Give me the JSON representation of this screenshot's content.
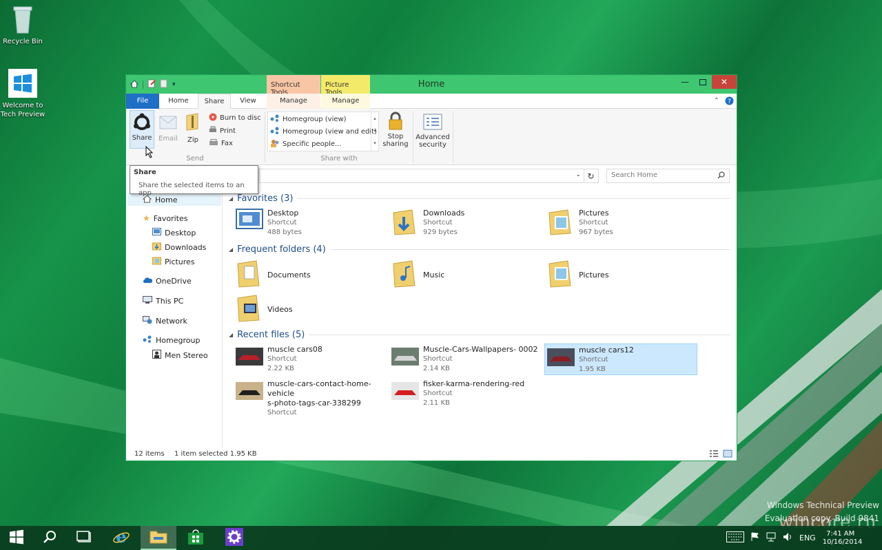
{
  "desktop": {
    "icons": [
      {
        "label": "Recycle Bin"
      },
      {
        "label": "Welcome to Tech Preview"
      }
    ],
    "watermark": {
      "line1": "Windows Technical Preview",
      "line2": "Evaluation copy. Build 9841"
    },
    "site": "wincore.ru"
  },
  "window": {
    "title": "Home",
    "context_tabs": {
      "shortcut": "Shortcut Tools",
      "picture": "Picture Tools"
    },
    "tabs": {
      "file": "File",
      "home": "Home",
      "share": "Share",
      "view": "View",
      "manage1": "Manage",
      "manage2": "Manage"
    },
    "ribbon": {
      "send": {
        "share": "Share",
        "email": "Email",
        "zip": "Zip",
        "burn": "Burn to disc",
        "print": "Print",
        "fax": "Fax",
        "group": "Send"
      },
      "share_with": {
        "items": [
          "Homegroup (view)",
          "Homegroup (view and edit)",
          "Specific people..."
        ],
        "stop_line1": "Stop",
        "stop_line2": "sharing",
        "group": "Share with"
      },
      "advanced": {
        "line1": "Advanced",
        "line2": "security"
      }
    },
    "tooltip": {
      "title": "Share",
      "text": "Share the selected items to an app"
    },
    "search": {
      "placeholder": "Search Home"
    },
    "nav": {
      "home": "Home",
      "favorites": "Favorites",
      "desktop": "Desktop",
      "downloads": "Downloads",
      "pictures": "Pictures",
      "onedrive": "OneDrive",
      "thispc": "This PC",
      "network": "Network",
      "homegroup": "Homegroup",
      "men_stereo": "Men Stereo"
    },
    "sections": {
      "favorites": "Favorites (3)",
      "frequent": "Frequent folders (4)",
      "recent": "Recent files (5)"
    },
    "favorites": [
      {
        "name": "Desktop",
        "type": "Shortcut",
        "size": "488 bytes"
      },
      {
        "name": "Downloads",
        "type": "Shortcut",
        "size": "929 bytes"
      },
      {
        "name": "Pictures",
        "type": "Shortcut",
        "size": "967 bytes"
      }
    ],
    "frequent": [
      {
        "name": "Documents"
      },
      {
        "name": "Music"
      },
      {
        "name": "Pictures"
      },
      {
        "name": "Videos"
      }
    ],
    "recent": [
      {
        "name": "muscle cars08",
        "type": "Shortcut",
        "size": "2.22 KB"
      },
      {
        "name": "Muscle-Cars-Wallpapers- 0002",
        "type": "Shortcut",
        "size": "2.14 KB"
      },
      {
        "name": "muscle cars12",
        "type": "Shortcut",
        "size": "1.95 KB"
      },
      {
        "name1": "muscle-cars-contact-home-vehicle",
        "name2": "s-photo-tags-car-338299",
        "type": "Shortcut"
      },
      {
        "name": "fisker-karma-rendering-red",
        "type": "Shortcut",
        "size": "2.11 KB"
      }
    ],
    "status": {
      "count": "12 items",
      "selected": "1 item selected  1.95 KB"
    }
  },
  "taskbar": {
    "lang": "ENG",
    "time": "7:41 AM",
    "date": "10/16/2014"
  },
  "colors": {
    "title_bar": "#3ec671",
    "file_tab": "#1e6fc5",
    "section_heading": "#1e4e8c",
    "selection": "#cce8ff"
  }
}
